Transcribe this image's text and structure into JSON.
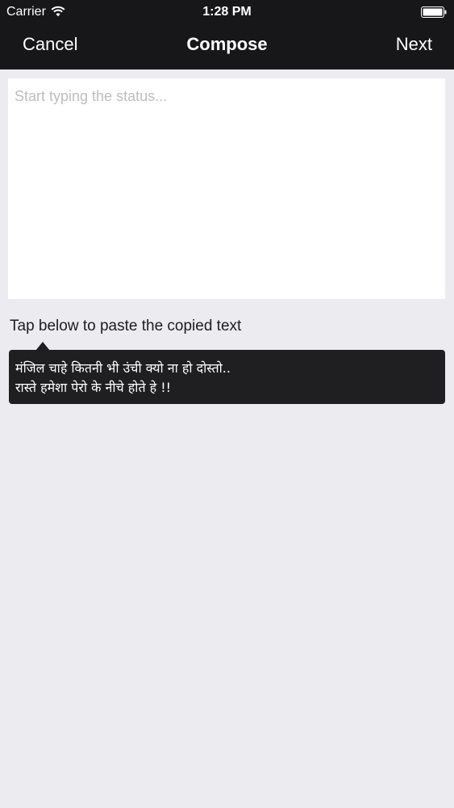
{
  "status_bar": {
    "carrier": "Carrier",
    "time": "1:28 PM"
  },
  "nav": {
    "cancel_label": "Cancel",
    "title": "Compose",
    "next_label": "Next"
  },
  "compose": {
    "placeholder": "Start typing the status...",
    "value": ""
  },
  "paste": {
    "hint": "Tap below to paste the copied text",
    "line1": "मंजिल चाहे कितनी भी उंची क्यो ना हो दोस्तो..",
    "line2": "रास्ते हमेशा पेरो के नीचे होते हे !!"
  },
  "icons": {
    "wifi": "wifi-icon",
    "battery": "battery-icon"
  },
  "colors": {
    "bar_background": "#17171a",
    "page_background": "#ebebf0",
    "bubble_background": "#1f1f22"
  }
}
